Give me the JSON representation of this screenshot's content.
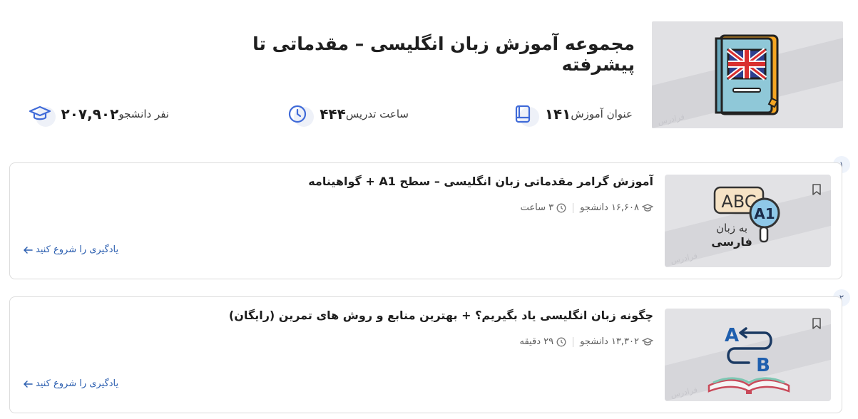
{
  "header": {
    "title": "مجموعه آموزش زبان انگلیسی – مقدماتی تا پیشرفته",
    "image_icon": "english-book-uk-flag-icon",
    "watermark": "فرادرس"
  },
  "stats": {
    "courses": {
      "value": "۱۴۱",
      "label": "عنوان آموزش",
      "icon": "book-stack-icon"
    },
    "hours": {
      "value": "۴۴۴",
      "label": "ساعت تدریس",
      "icon": "clock-icon"
    },
    "students": {
      "value": "۲۰۷,۹۰۲",
      "label": "نفر دانشجو",
      "icon": "graduation-cap-icon"
    }
  },
  "courses": [
    {
      "index": "۱",
      "title": "آموزش گرامر مقدماتی زبان انگلیسی – سطح A1 + گواهینامه",
      "students": "۱۶,۶۰۸ دانشجو",
      "duration": "۳ ساعت",
      "cta": "یادگیری را شروع کنید",
      "thumb": {
        "abc": "ABC",
        "badge": "A1",
        "caption_line1": "به زبان",
        "caption_line2": "فارسی",
        "watermark": "فرادرس"
      }
    },
    {
      "index": "۲",
      "title": "چگونه زبان انگلیسی یاد بگیریم؟ + بهترین منابع و روش های تمرین (رایگان)",
      "students": "۱۳,۳۰۲ دانشجو",
      "duration": "۲۹ دقیقه",
      "cta": "یادگیری را شروع کنید",
      "thumb": {
        "letter_a": "A",
        "letter_b": "B",
        "watermark": "فرادرس"
      }
    }
  ],
  "colors": {
    "accent": "#2c5fb0",
    "icon_blue": "#3f6ad8",
    "card_border": "#dcdcdc",
    "thumb_bg": "#e2e2e5"
  }
}
